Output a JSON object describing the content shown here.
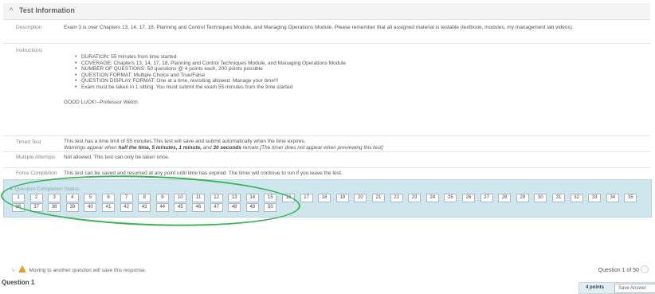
{
  "test_info": {
    "title": "Test Information",
    "description_label": "Description",
    "description": "Exam 3 is over Chapters 13, 14, 17, 18, Planning and Control Techniques Module, and Managing Operations Module.  Please remember that all assigned material is testable (textbook, modules, my management lab videos).",
    "instructions_label": "Instructions",
    "instructions": [
      "DURATION: 55 minutes from time started",
      "COVERAGE: Chapters 13, 14, 17, 18, Planning and Control Techniques Module, and Managing Operations Module",
      "NUMBER OF QUESTIONS: 50 questions @ 4 points each, 200 points possible",
      "QUESTION FORMAT: Multiple Choice and True/False",
      "QUESTION DISPLAY FORMAT: One at a time, revisiting allowed.  Manage your time!!!",
      "Exam must be taken in 1 sitting.  You must submit the exam 55 minutes from the time started"
    ],
    "signoff": "GOOD LUCK!--Professor Welch",
    "timed_label": "Timed Test",
    "timed_line1": "This test has a time limit of 55 minutes.This test will save and submit automatically when the time expires.",
    "timed_line2_prefix": "Warnings appear when ",
    "timed_line2_bold": "half the time, 5 minutes, 1 minute,",
    "timed_line2_mid": " and ",
    "timed_line2_bold2": "30 seconds",
    "timed_line2_suffix": " remain.[The timer does not appear when previewing this test]",
    "attempts_label": "Multiple Attempts",
    "attempts": "Not allowed. This test can only be taken once.",
    "force_label": "Force Completion",
    "force": "This test can be saved and resumed at any point until time has expired. The timer will continue to run if you leave the test."
  },
  "status": {
    "title": "Question Completion Status:",
    "questions": [
      "1",
      "2",
      "3",
      "4",
      "5",
      "6",
      "7",
      "8",
      "9",
      "10",
      "11",
      "12",
      "13",
      "14",
      "15",
      "16",
      "17",
      "18",
      "19",
      "20",
      "21",
      "22",
      "23",
      "24",
      "25",
      "26",
      "27",
      "28",
      "29",
      "30",
      "31",
      "32",
      "33",
      "34",
      "35",
      "36",
      "37",
      "38",
      "39",
      "40",
      "41",
      "42",
      "43",
      "44",
      "45",
      "46",
      "47",
      "48",
      "49",
      "50"
    ]
  },
  "footer": {
    "move_warning": "Moving to another question will save this response.",
    "question_counter": "Question 1 of 50",
    "question_heading": "Question 1",
    "points": "4 points",
    "save_answer": "Save Answer"
  },
  "colors": {
    "panel": "#cfe6ee",
    "annotation": "#35b554",
    "warning": "#e2a02a"
  }
}
